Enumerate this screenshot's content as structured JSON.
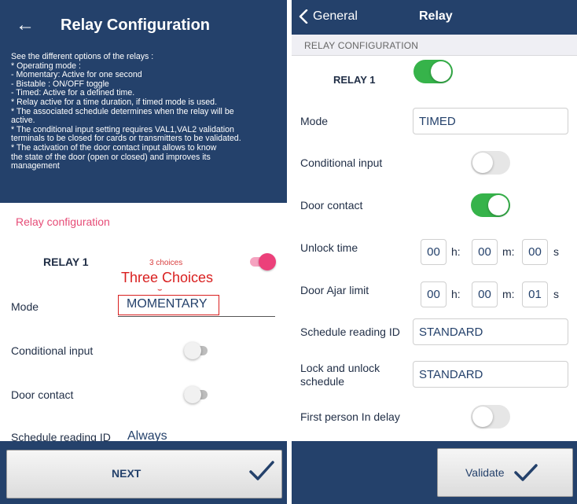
{
  "left": {
    "title": "Relay Configuration",
    "help": [
      "See the different options of the relays :",
      "* Operating mode :",
      " - Momentary: Active for one second",
      " - Bistable : ON/OFF toggle",
      " - Timed: Active for a defined time.",
      "* Relay active for a time duration, if timed mode is used.",
      "* The associated schedule determines when the relay will be",
      "active.",
      "* The conditional input setting requires VAL1,VAL2 validation",
      "terminals to be closed for cards or transmitters to be validated.",
      "* The activation of the door contact input allows to know",
      "the state of the door (open or closed) and improves its",
      "management"
    ],
    "section": "Relay configuration",
    "relay_label": "RELAY 1",
    "relay_on": true,
    "choices_note": "3 choices",
    "annotation": "Three Choices",
    "mode_label": "Mode",
    "mode_value": "MOMENTARY",
    "conditional_label": "Conditional input",
    "conditional_on": false,
    "door_label": "Door contact",
    "door_on": false,
    "schedule_label": "Schedule reading ID",
    "schedule_value": "Always",
    "next_label": "NEXT",
    "colors": {
      "header": "#24416b",
      "accent": "#ec407a",
      "annotation": "#d92020"
    }
  },
  "right": {
    "back_label": "General",
    "title": "Relay",
    "section": "RELAY CONFIGURATION",
    "relay_label": "RELAY 1",
    "relay_on": true,
    "mode_label": "Mode",
    "mode_value": "TIMED",
    "conditional_label": "Conditional input",
    "conditional_on": false,
    "door_label": "Door contact",
    "door_on": true,
    "unlock_label": "Unlock time",
    "unlock": {
      "h": "00",
      "m": "00",
      "s": "00"
    },
    "ajar_label": "Door Ajar limit",
    "ajar": {
      "h": "00",
      "m": "00",
      "s": "01"
    },
    "units": {
      "h": "h:",
      "m": "m:",
      "s": "s"
    },
    "schedule_label": "Schedule reading ID",
    "schedule_value": "STANDARD",
    "lock_label_1": "Lock and unlock",
    "lock_label_2": "schedule",
    "lock_value": "STANDARD",
    "first_person_label": "First person In delay",
    "first_person_on": false,
    "validate_label": "Validate",
    "colors": {
      "nav": "#24416b",
      "toggle_on": "#36b34a"
    }
  }
}
